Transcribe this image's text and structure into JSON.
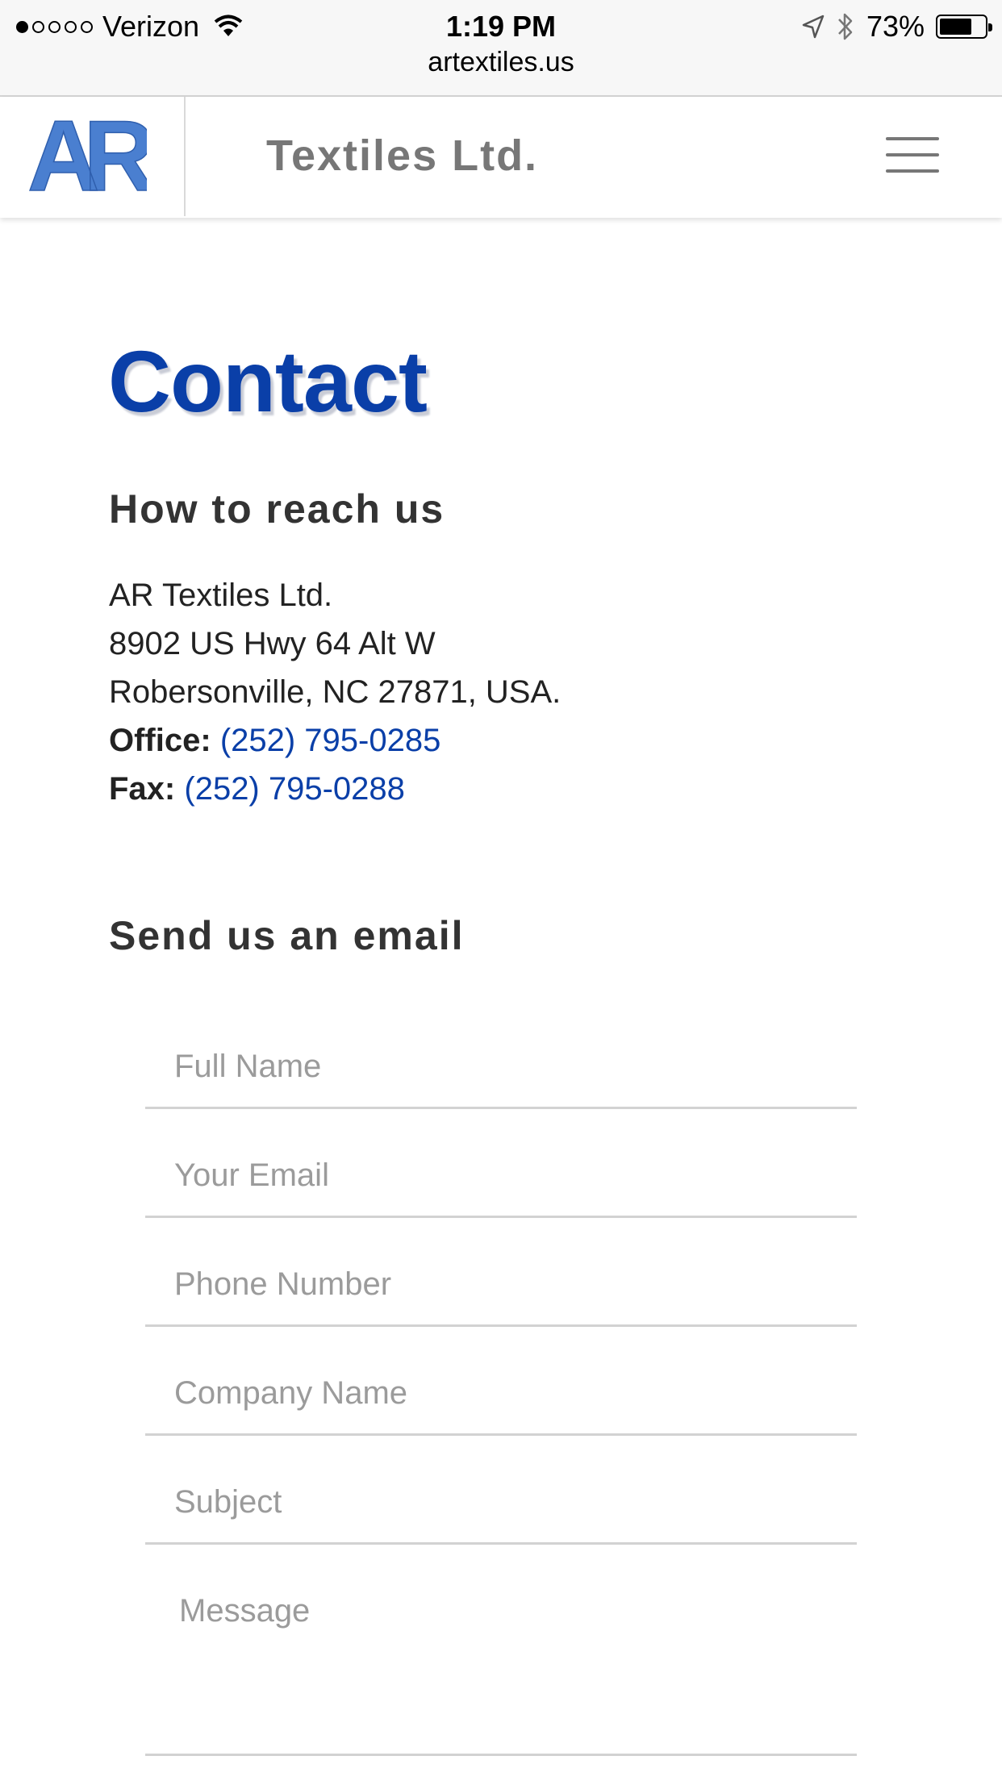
{
  "status_bar": {
    "carrier": "Verizon",
    "time": "1:19 PM",
    "battery": "73%",
    "battery_level": 0.73,
    "url": "artextiles.us"
  },
  "header": {
    "logo_text": "AR",
    "brand": "Textiles Ltd.",
    "logo_color": "#4a7fd0",
    "menu_icon": "hamburger-menu-icon"
  },
  "page": {
    "title": "Contact",
    "title_color": "#0a3fa8"
  },
  "contact": {
    "heading": "How to reach us",
    "company": "AR Textiles Ltd.",
    "street": "8902 US Hwy 64 Alt W",
    "city": "Robersonville, NC 27871, USA.",
    "office_label": "Office:",
    "office_phone": "(252) 795-0285",
    "fax_label": "Fax:",
    "fax_phone": "(252) 795-0288"
  },
  "form": {
    "heading": "Send us an email",
    "fields": {
      "full_name": "Full Name",
      "email": "Your Email",
      "phone": "Phone Number",
      "company": "Company Name",
      "subject": "Subject",
      "message": "Message"
    }
  }
}
